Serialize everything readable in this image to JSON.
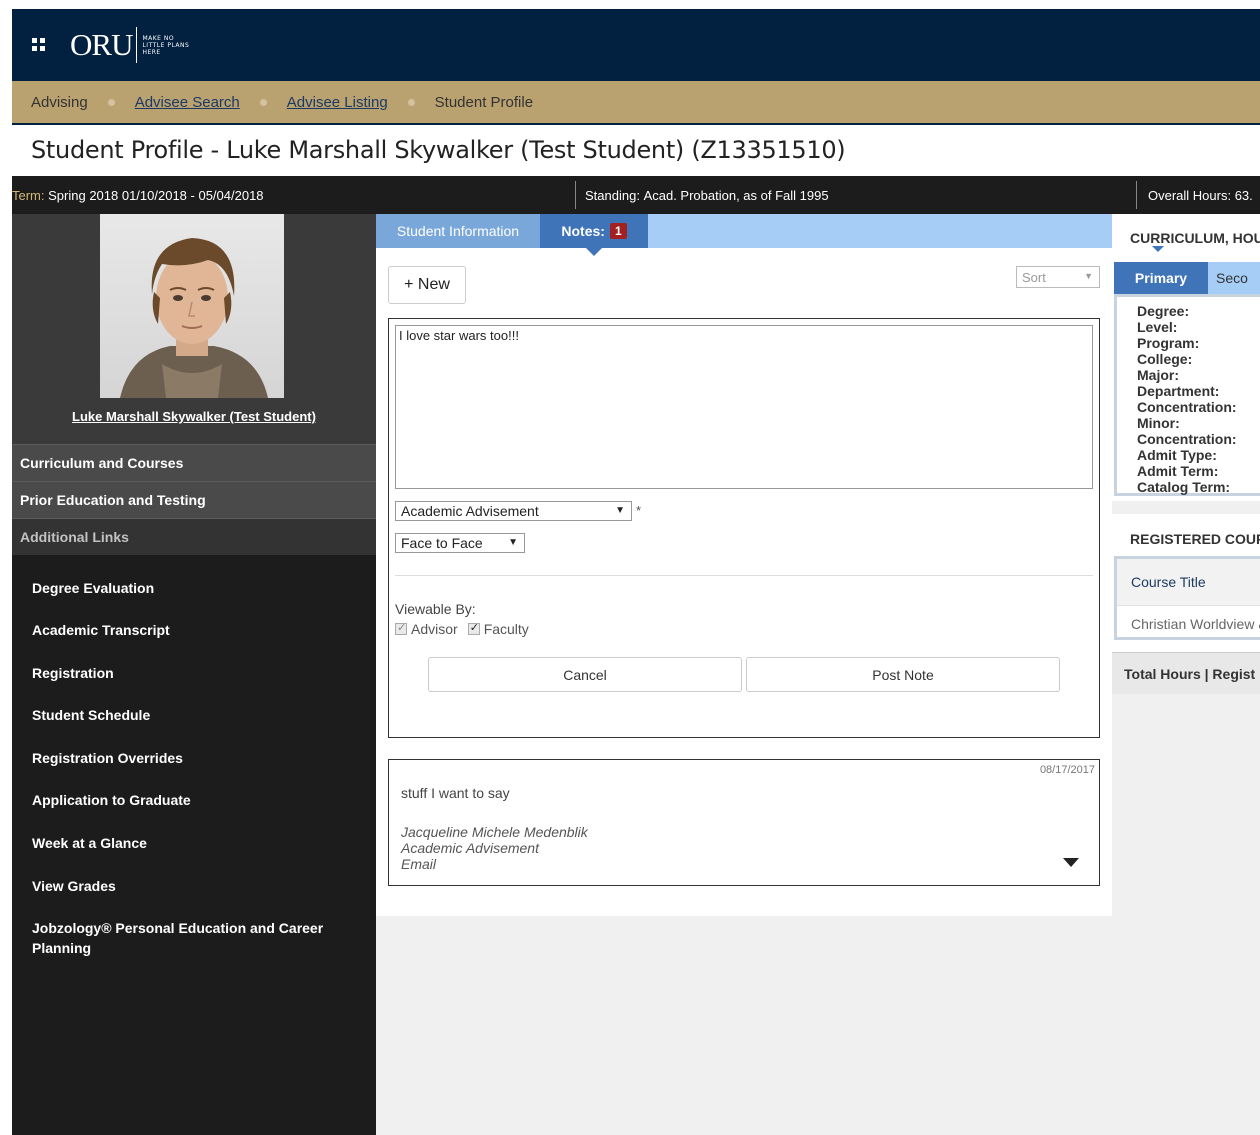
{
  "header": {
    "logo_word": "ORU",
    "logo_tagline": [
      "MAKE NO",
      "LITTLE PLANS",
      "HERE"
    ],
    "brand_color": "#022140"
  },
  "breadcrumb": {
    "items": [
      "Advising",
      "Advisee Search",
      "Advisee Listing",
      "Student Profile"
    ]
  },
  "page_title": "Student Profile - Luke Marshall Skywalker (Test Student) (Z13351510)",
  "status": {
    "term_label": "Term:",
    "term_value": "Spring 2018 01/10/2018 - 05/04/2018",
    "standing_label": "Standing:",
    "standing_value": "Acad. Probation, as of Fall 1995",
    "hours_label": "Overall Hours:",
    "hours_value": "63."
  },
  "sidebar": {
    "student_name": "Luke Marshall Skywalker (Test Student)",
    "sections": [
      "Curriculum and Courses",
      "Prior Education and Testing",
      "Additional Links"
    ],
    "links": [
      "Degree Evaluation",
      "Academic Transcript",
      "Registration",
      "Student Schedule",
      "Registration Overrides",
      "Application to Graduate",
      "Week at a Glance",
      "View Grades",
      "Jobzology® Personal Education and Career Planning"
    ]
  },
  "main": {
    "tabs": {
      "info": "Student Information",
      "notes": "Notes:",
      "notes_count": "1"
    },
    "new_button": "+ New",
    "sort_placeholder": "Sort",
    "form": {
      "note_text": "I love star wars too!!!",
      "category": "Academic Advisement",
      "contact_type": "Face to Face",
      "required_mark": "*",
      "viewable_label": "Viewable By:",
      "viewable_advisor": "Advisor",
      "viewable_faculty": "Faculty",
      "cancel_button": "Cancel",
      "post_button": "Post Note"
    },
    "note": {
      "date": "08/17/2017",
      "body": "stuff I want to say",
      "author": "Jacqueline Michele Medenblik",
      "category": "Academic Advisement",
      "contact": "Email"
    }
  },
  "right": {
    "curriculum_header": "CURRICULUM, HOU",
    "subtab_primary": "Primary",
    "subtab_secondary": "Seco",
    "fields": [
      "Degree:",
      "Level:",
      "Program:",
      "College:",
      "Major:",
      "Department:",
      "Concentration:",
      "Minor:",
      "Concentration:",
      "Admit Type:",
      "Admit Term:",
      "Catalog Term:"
    ],
    "registered_header": "REGISTERED COUR",
    "table_header": "Course Title",
    "table_row": "Christian Worldview &",
    "totals": "Total Hours |  Regist"
  }
}
